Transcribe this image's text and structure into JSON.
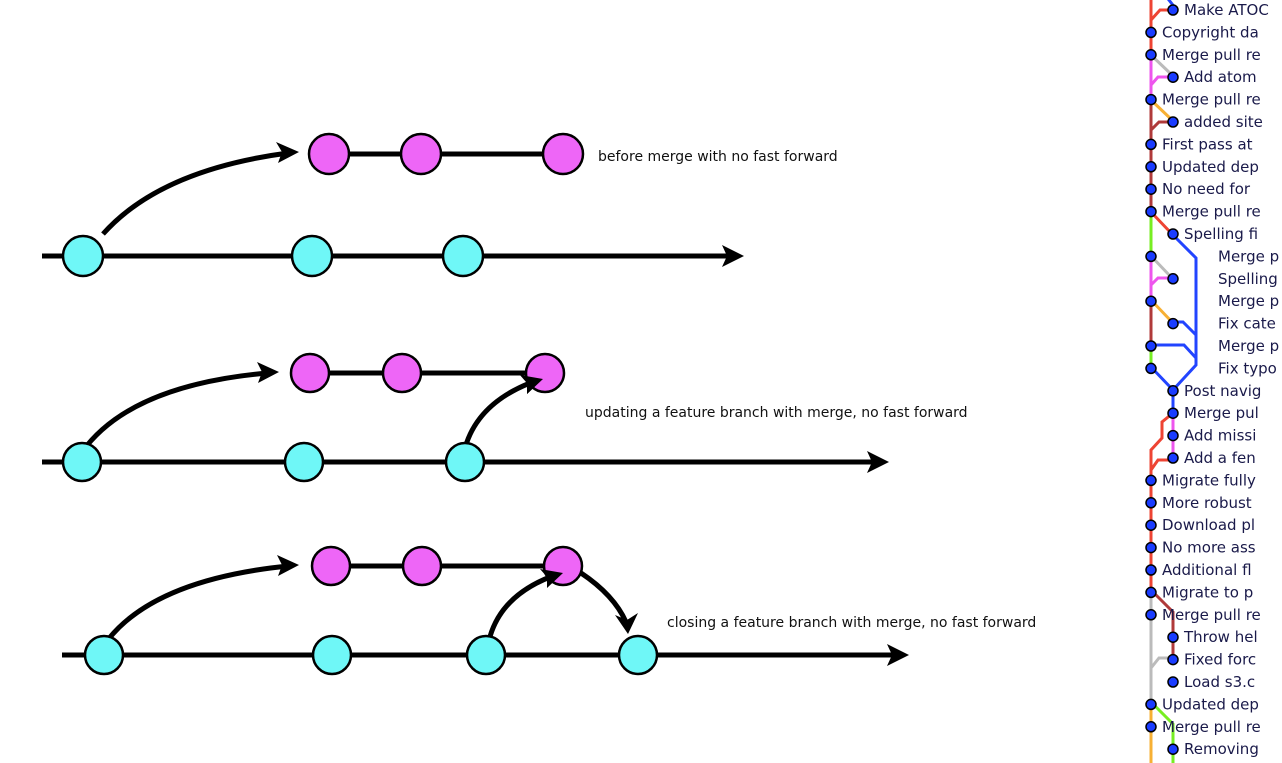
{
  "colors": {
    "main_commit": "#6ff7f7",
    "feature_commit": "#ee66f7",
    "stroke": "#000000",
    "graph_dot": "#1a3cff"
  },
  "diagrams": [
    {
      "id": "before-merge",
      "caption": "before merge with no fast forward",
      "main_commits": 3,
      "feature_commits": 3,
      "steps": [
        "branch"
      ]
    },
    {
      "id": "update-feature",
      "caption": "updating a feature branch with merge, no fast forward",
      "main_commits": 3,
      "feature_commits": 3,
      "steps": [
        "branch",
        "merge-main-into-feature"
      ]
    },
    {
      "id": "close-feature",
      "caption": "closing a feature branch with merge, no fast forward",
      "main_commits": 4,
      "feature_commits": 3,
      "steps": [
        "branch",
        "merge-main-into-feature",
        "merge-feature-into-main"
      ]
    }
  ],
  "git_log": {
    "lane_colors": {
      "red": "#ee4433",
      "darkred": "#b03a3a",
      "magenta": "#ee55ee",
      "gray": "#bbbbbb",
      "orange": "#f7b034",
      "green": "#77ee22",
      "blue": "#2244ff"
    },
    "entries": [
      {
        "label": "Make ATOC",
        "lane": 1
      },
      {
        "label": "Copyright da",
        "lane": 0
      },
      {
        "label": "Merge pull re",
        "lane": 0
      },
      {
        "label": "Add atom",
        "lane": 1
      },
      {
        "label": "Merge pull re",
        "lane": 0
      },
      {
        "label": "added site",
        "lane": 1
      },
      {
        "label": "First pass at",
        "lane": 0
      },
      {
        "label": "Updated dep",
        "lane": 0
      },
      {
        "label": "No need for",
        "lane": 0
      },
      {
        "label": "Merge pull re",
        "lane": 0
      },
      {
        "label": "Spelling fi",
        "lane": 1
      },
      {
        "label": "Merge p",
        "lane": 0,
        "indent": 2
      },
      {
        "label": "Spelling",
        "lane": 1,
        "indent": 2
      },
      {
        "label": "Merge p",
        "lane": 0,
        "indent": 2
      },
      {
        "label": "Fix cate",
        "lane": 1,
        "indent": 2
      },
      {
        "label": "Merge p",
        "lane": 0,
        "indent": 2
      },
      {
        "label": "Fix typo",
        "lane": 0,
        "indent": 2
      },
      {
        "label": "Post navig",
        "lane": 1
      },
      {
        "label": "Merge pul",
        "lane": 1
      },
      {
        "label": "Add missi",
        "lane": 1
      },
      {
        "label": "Add a fen",
        "lane": 1
      },
      {
        "label": "Migrate fully",
        "lane": 0
      },
      {
        "label": "More robust",
        "lane": 0
      },
      {
        "label": "Download pl",
        "lane": 0
      },
      {
        "label": "No more ass",
        "lane": 0
      },
      {
        "label": "Additional fl",
        "lane": 0
      },
      {
        "label": "Migrate to p",
        "lane": 0
      },
      {
        "label": "Merge pull re",
        "lane": 0
      },
      {
        "label": "Throw hel",
        "lane": 1
      },
      {
        "label": "Fixed forc",
        "lane": 1
      },
      {
        "label": "Load s3.c",
        "lane": 1
      },
      {
        "label": "Updated dep",
        "lane": 0
      },
      {
        "label": "Merge pull re",
        "lane": 0
      },
      {
        "label": "Removing",
        "lane": 1
      }
    ]
  }
}
